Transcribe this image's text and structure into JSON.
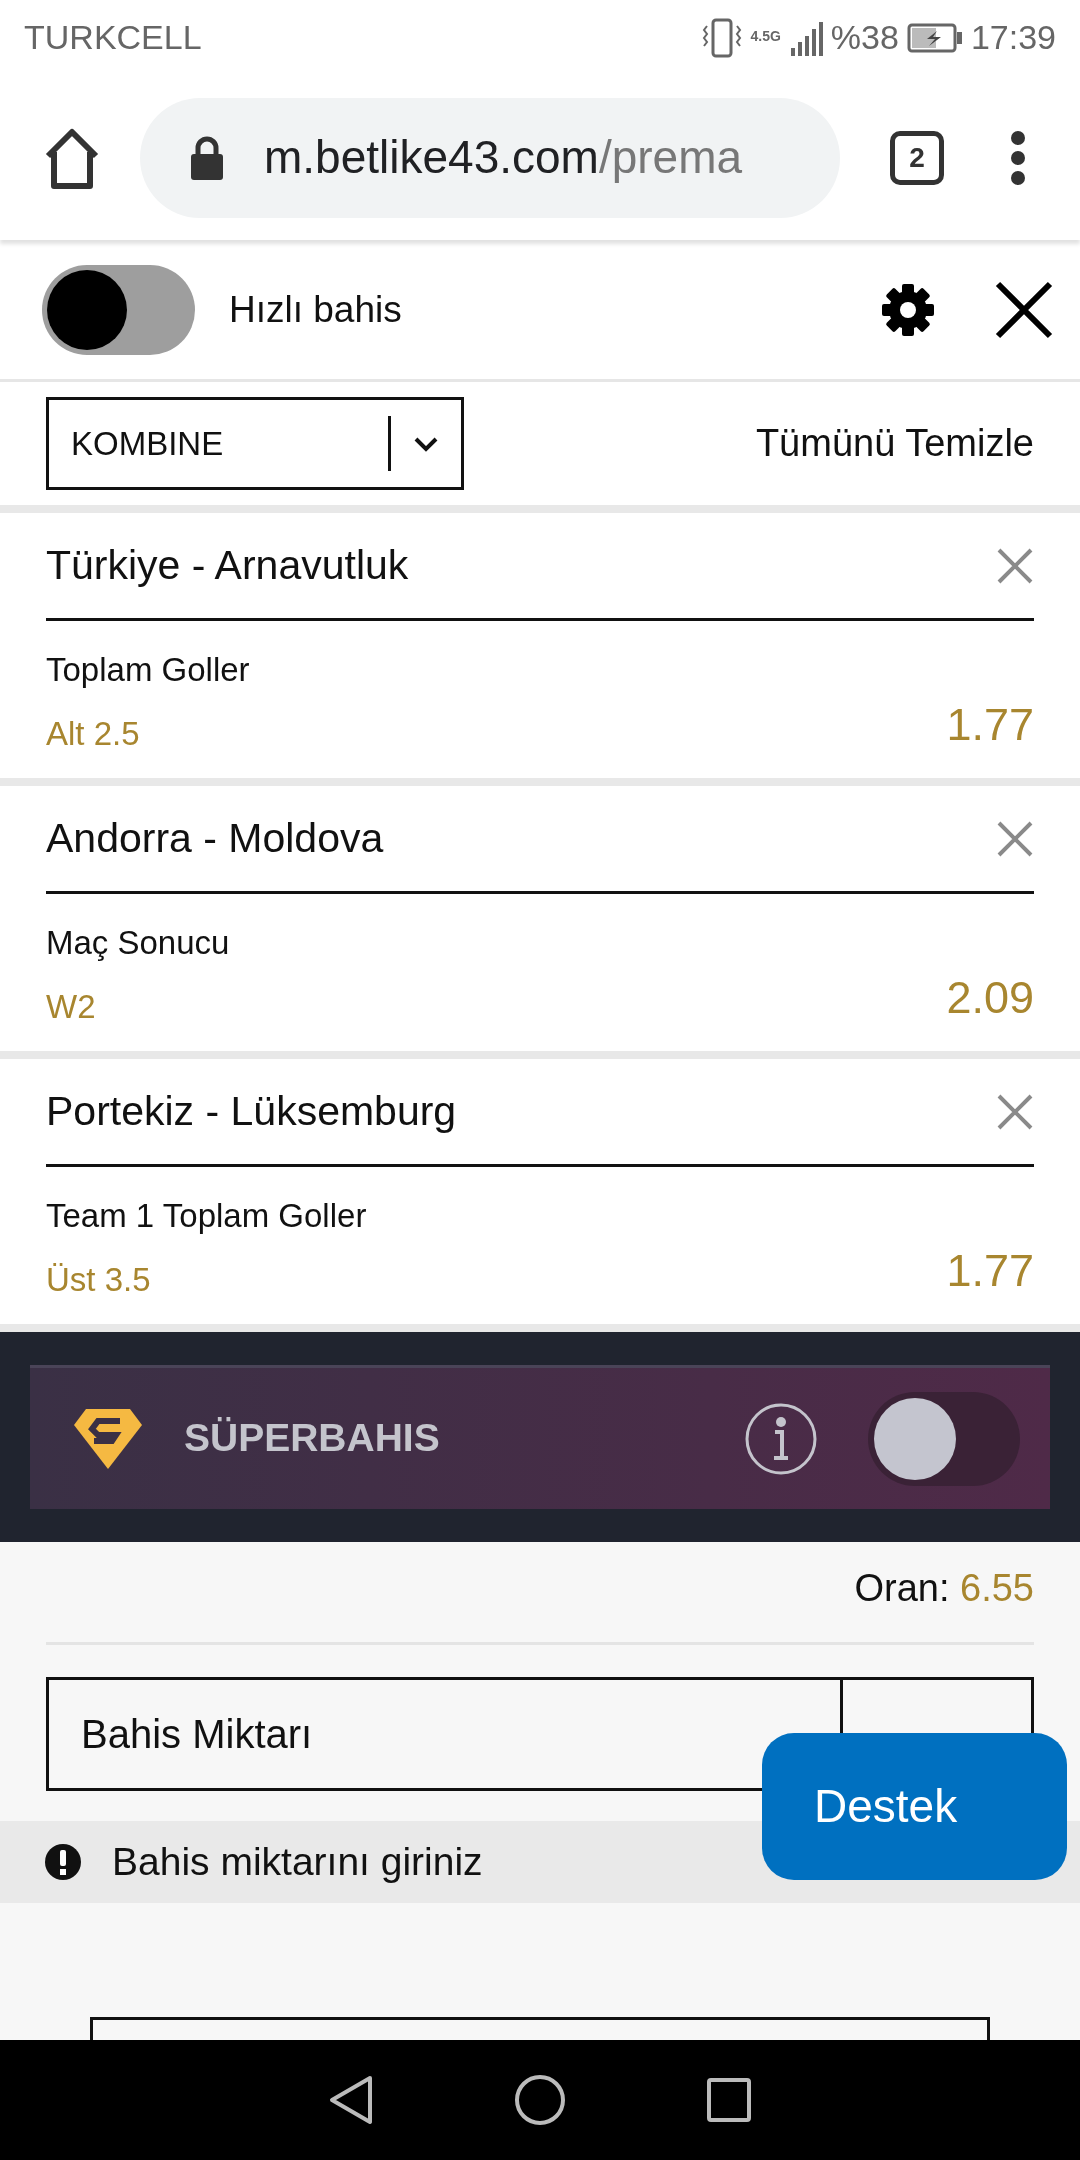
{
  "status_bar": {
    "carrier": "TURKCELL",
    "network": "4.5G",
    "battery": "%38",
    "time": "17:39"
  },
  "browser": {
    "url_host": "m.betlike43.com",
    "url_path": "/prema",
    "tab_count": "2"
  },
  "quick_bet": {
    "label": "Hızlı bahis",
    "on": false
  },
  "bet_type": {
    "value": "KOMBINE"
  },
  "clear_all": "Tümünü Temizle",
  "bets": [
    {
      "match": "Türkiye - Arnavutluk",
      "market": "Toplam Goller",
      "selection": "Alt 2.5",
      "odds": "1.77"
    },
    {
      "match": "Andorra - Moldova",
      "market": "Maç Sonucu",
      "selection": "W2",
      "odds": "2.09"
    },
    {
      "match": "Portekiz - Lüksemburg",
      "market": "Team 1 Toplam Goller",
      "selection": "Üst 3.5",
      "odds": "1.77"
    }
  ],
  "superbahis": {
    "label": "SÜPERBAHIS",
    "on": false
  },
  "total_odds": {
    "label": "Oran:",
    "value": "6.55"
  },
  "stake": {
    "placeholder": "Bahis Miktarı"
  },
  "warning": "Bahis miktarını giriniz",
  "support_button": "Destek"
}
